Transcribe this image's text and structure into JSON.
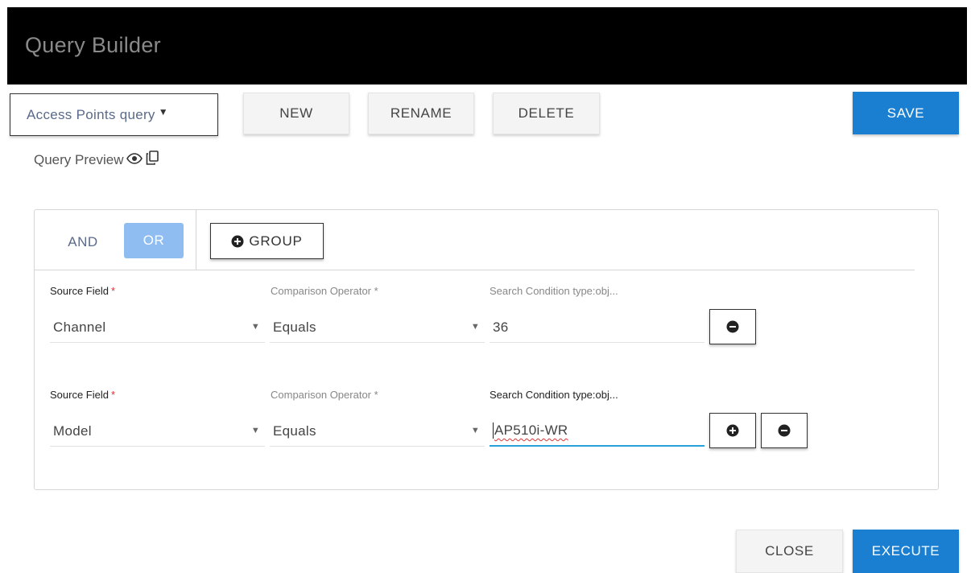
{
  "window": {
    "title": "Query Builder"
  },
  "toolbar": {
    "query_select": "Access Points query",
    "new_label": "NEW",
    "rename_label": "RENAME",
    "delete_label": "DELETE",
    "save_label": "SAVE"
  },
  "preview": {
    "label": "Query Preview",
    "icons": [
      "eye-icon",
      "copy-icon"
    ]
  },
  "logic": {
    "and_label": "AND",
    "or_label": "OR",
    "selected": "OR",
    "group_label": "GROUP"
  },
  "rows": [
    {
      "source_label": "Source Field",
      "operator_label": "Comparison Operator *",
      "condition_label": "Search Condition type:obj...",
      "source_value": "Channel",
      "operator_value": "Equals",
      "condition_value": "36"
    },
    {
      "source_label": "Source Field",
      "operator_label": "Comparison Operator *",
      "condition_label": "Search Condition type:obj...",
      "source_value": "Model",
      "operator_value": "Equals",
      "condition_value": "AP510i-WR"
    }
  ],
  "footer": {
    "close_label": "CLOSE",
    "execute_label": "EXECUTE"
  },
  "colors": {
    "primary": "#1a7fd1",
    "or_selected": "#8fbdf2",
    "titlebar": "#000000",
    "required": "#e03030",
    "active_underline": "#2a9fd8"
  }
}
